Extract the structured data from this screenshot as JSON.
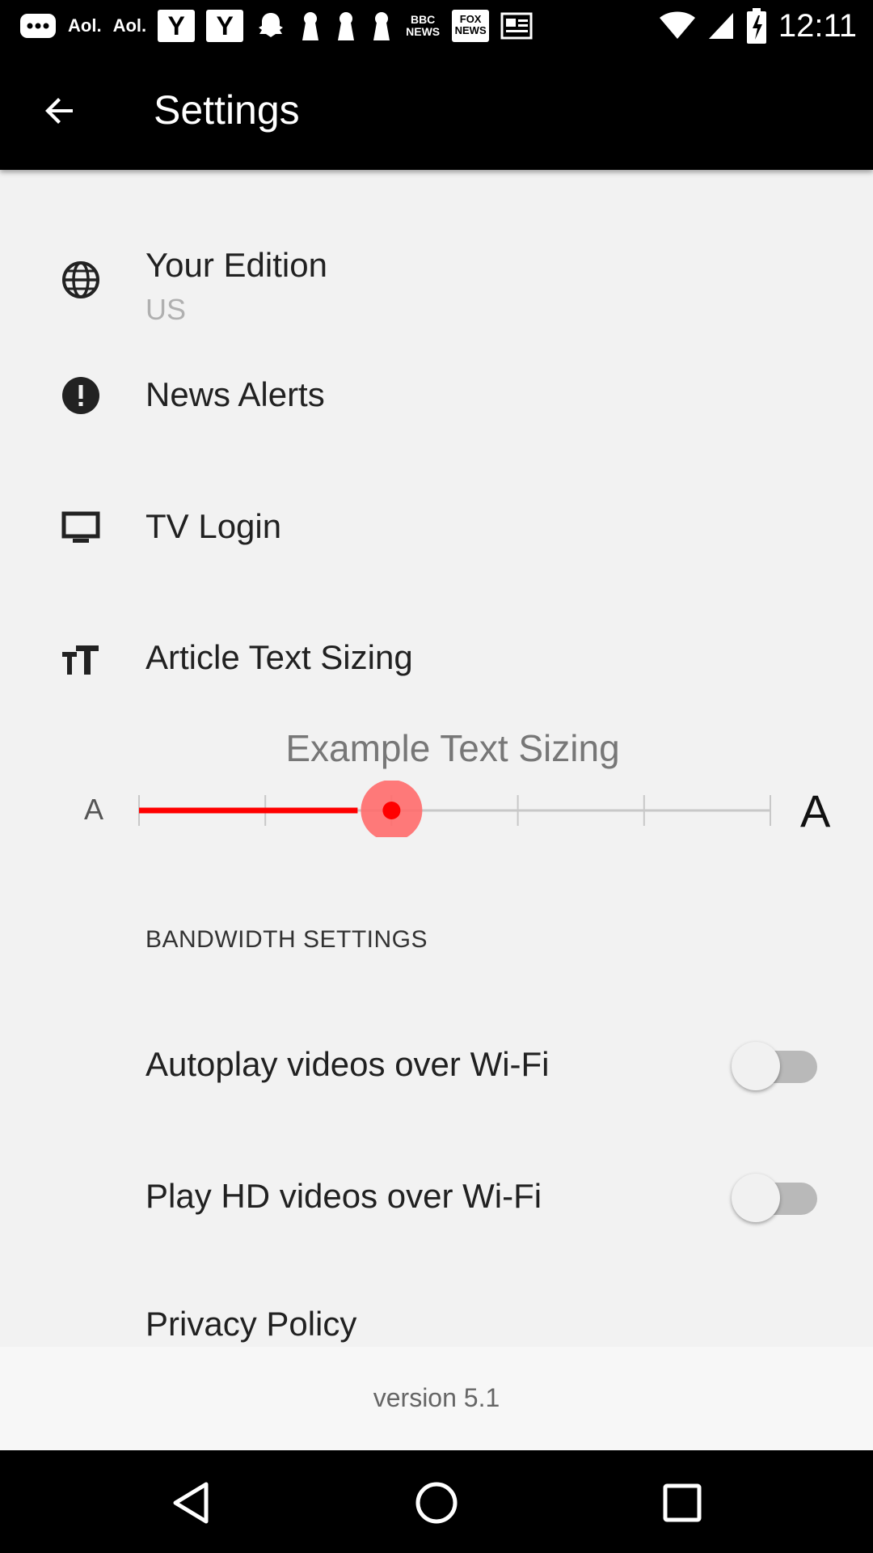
{
  "status_bar": {
    "time": "12:11",
    "notification_icons": [
      "messages-icon",
      "aol-icon",
      "aol-icon",
      "yahoo-icon",
      "yahoo-icon",
      "snapchat-icon",
      "keyhole-icon",
      "keyhole-icon",
      "keyhole-icon",
      "bbc-news-icon",
      "fox-news-icon",
      "news-icon"
    ],
    "aol_label": "Aol.",
    "yahoo_label": "Y",
    "bbc_label": "BBC NEWS",
    "fox_label": "FOX NEWS"
  },
  "app_bar": {
    "title": "Settings"
  },
  "settings": {
    "edition": {
      "label": "Your Edition",
      "value": "US"
    },
    "alerts": {
      "label": "News Alerts"
    },
    "tv_login": {
      "label": "TV Login"
    },
    "text_sizing": {
      "label": "Article Text Sizing",
      "example": "Example Text Sizing",
      "small_a": "A",
      "large_a": "A",
      "steps": 6,
      "selected_step": 3
    },
    "bandwidth": {
      "header": "BANDWIDTH SETTINGS",
      "autoplay": {
        "label": "Autoplay videos over Wi-Fi",
        "enabled": false
      },
      "hd": {
        "label": "Play HD videos over Wi-Fi",
        "enabled": false
      }
    },
    "privacy": {
      "label": "Privacy Policy"
    }
  },
  "footer": {
    "version": "version 5.1"
  },
  "colors": {
    "accent": "#ff0000",
    "thumb_halo": "#ff6b6b",
    "background": "#f2f2f2"
  }
}
